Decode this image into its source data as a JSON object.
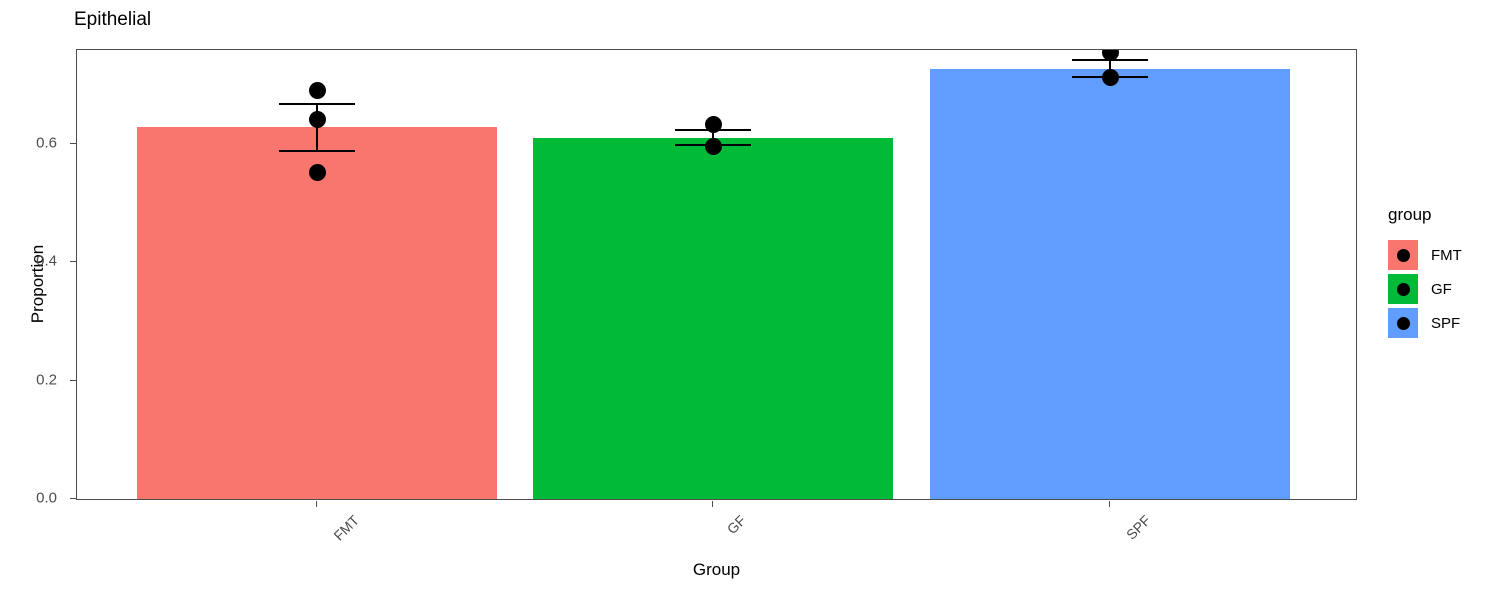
{
  "title": "Epithelial",
  "axes": {
    "ylabel": "Proportion",
    "xlabel": "Group",
    "yticks": [
      "0.0",
      "0.2",
      "0.4",
      "0.6"
    ],
    "xticks": [
      "FMT",
      "GF",
      "SPF"
    ]
  },
  "legend": {
    "title": "group",
    "items": [
      {
        "label": "FMT",
        "color": "#F8766D"
      },
      {
        "label": "GF",
        "color": "#00BA38"
      },
      {
        "label": "SPF",
        "color": "#619CFF"
      }
    ]
  },
  "chart_data": {
    "type": "bar",
    "title": "Epithelial",
    "xlabel": "Group",
    "ylabel": "Proportion",
    "categories": [
      "FMT",
      "GF",
      "SPF"
    ],
    "values": [
      0.625,
      0.607,
      0.723
    ],
    "errors_low": [
      0.588,
      0.598,
      0.713
    ],
    "errors_high": [
      0.667,
      0.623,
      0.742
    ],
    "colors": [
      "#F8766D",
      "#00BA38",
      "#619CFF"
    ],
    "points": [
      {
        "category": "FMT",
        "values": [
          0.691,
          0.641,
          0.552
        ]
      },
      {
        "category": "GF",
        "values": [
          0.633,
          0.595
        ]
      },
      {
        "category": "SPF",
        "values": [
          0.755,
          0.712
        ]
      }
    ],
    "ylim": [
      0.0,
      0.763
    ],
    "yticks": [
      0.0,
      0.2,
      0.4,
      0.6
    ],
    "grid": false,
    "legend_position": "right",
    "legend_title": "group"
  }
}
